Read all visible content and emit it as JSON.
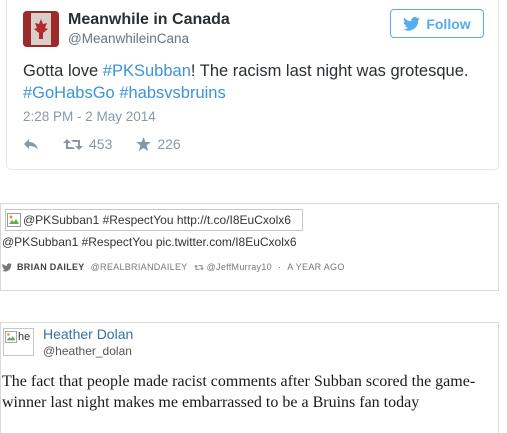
{
  "tweet": {
    "author_name": "Meanwhile in Canada",
    "author_handle": "@MeanwhileinCana",
    "follow_label": "Follow",
    "text_parts": {
      "t1": "Gotta love ",
      "l1": "#PKSubban",
      "t2": "! The racism last night was grotesque.",
      "l2": "#GoHabsGo",
      "t3": " ",
      "l3": "#habsvsbruins"
    },
    "time": "2:28 PM - 2 May 2014",
    "retweets": "453",
    "favorites": "226",
    "colors": {
      "link": "#3b94d9",
      "follow": "#55acee",
      "muted": "#8899a6"
    },
    "icons": {
      "reply": "reply-icon",
      "retweet": "retweet-icon",
      "favorite": "star-icon",
      "follow": "twitter-bird-icon"
    }
  },
  "link_card": {
    "image_alt": "@PKSubban1 #RespectYou http://t.co/I8EuCxolx6",
    "text": "@PKSubban1 #RespectYou pic.twitter.com/I8EuCxolx6",
    "meta": {
      "author": "BRIAN DAILEY",
      "handle": "@REALBRIANDAILEY",
      "retweeted_by": "@JeffMurray10",
      "separator": "·",
      "age": "A YEAR AGO"
    }
  },
  "quote": {
    "avatar_alt": "he",
    "name": "Heather Dolan",
    "handle": "@heather_dolan",
    "text": "The fact that people made racist comments after Subban scored the game-winner last night makes me embarrassed to be a Bruins fan today"
  }
}
